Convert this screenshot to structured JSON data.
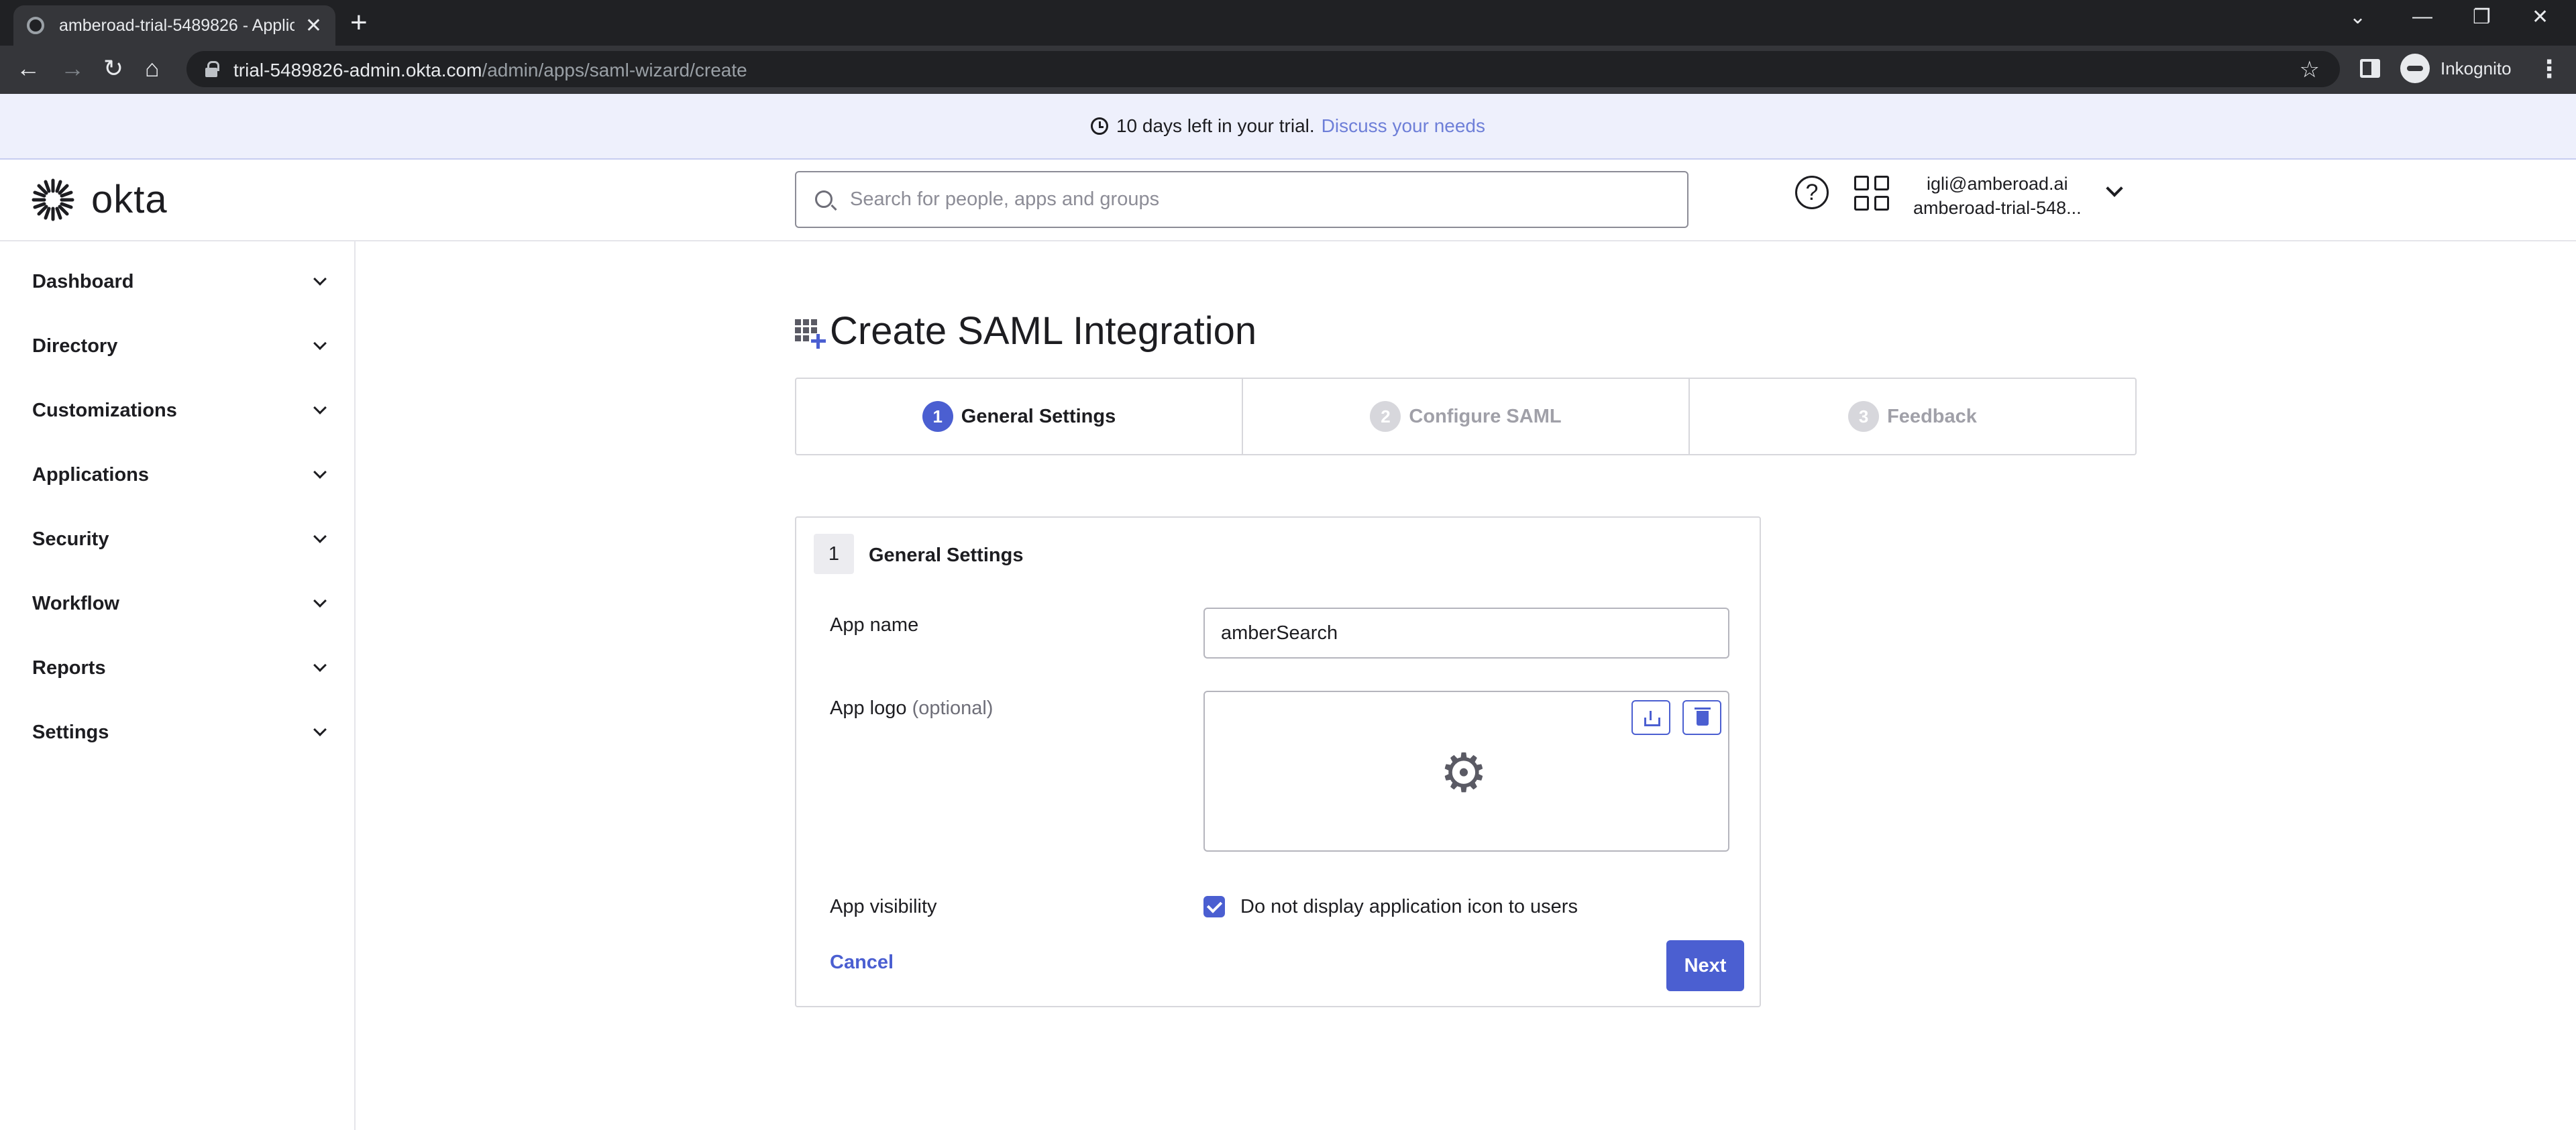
{
  "browser": {
    "tab_title": "amberoad-trial-5489826 - Applic",
    "url_host": "trial-5489826-admin.okta.com",
    "url_path": "/admin/apps/saml-wizard/create",
    "profile_label": "Inkognito"
  },
  "banner": {
    "text": "10 days left in your trial.",
    "link": "Discuss your needs"
  },
  "header": {
    "logo_text": "okta",
    "search_placeholder": "Search for people, apps and groups",
    "help_glyph": "?",
    "user_email": "igli@amberoad.ai",
    "user_org": "amberoad-trial-548..."
  },
  "sidebar": {
    "items": [
      {
        "label": "Dashboard"
      },
      {
        "label": "Directory"
      },
      {
        "label": "Customizations"
      },
      {
        "label": "Applications"
      },
      {
        "label": "Security"
      },
      {
        "label": "Workflow"
      },
      {
        "label": "Reports"
      },
      {
        "label": "Settings"
      }
    ]
  },
  "page": {
    "title": "Create SAML Integration",
    "steps": [
      {
        "num": "1",
        "label": "General Settings",
        "state": "active"
      },
      {
        "num": "2",
        "label": "Configure SAML",
        "state": "inactive"
      },
      {
        "num": "3",
        "label": "Feedback",
        "state": "inactive"
      }
    ]
  },
  "form": {
    "section_num": "1",
    "section_title": "General Settings",
    "app_name_label": "App name",
    "app_name_value": "amberSearch",
    "app_logo_label": "App logo",
    "app_logo_optional": "(optional)",
    "app_visibility_label": "App visibility",
    "visibility_checkbox_label": "Do not display application icon to users",
    "visibility_checked": true,
    "cancel_label": "Cancel",
    "next_label": "Next"
  },
  "colors": {
    "accent": "#4b5fd1",
    "banner_bg": "#eef0fc",
    "banner_link": "#6e7fd8"
  },
  "icons": [
    "okta-logo-icon",
    "search-icon",
    "help-icon",
    "app-switcher-icon",
    "chevron-down-icon",
    "app-grid-plus-icon",
    "upload-icon",
    "trash-icon",
    "gear-icon",
    "clock-icon",
    "check-icon"
  ]
}
